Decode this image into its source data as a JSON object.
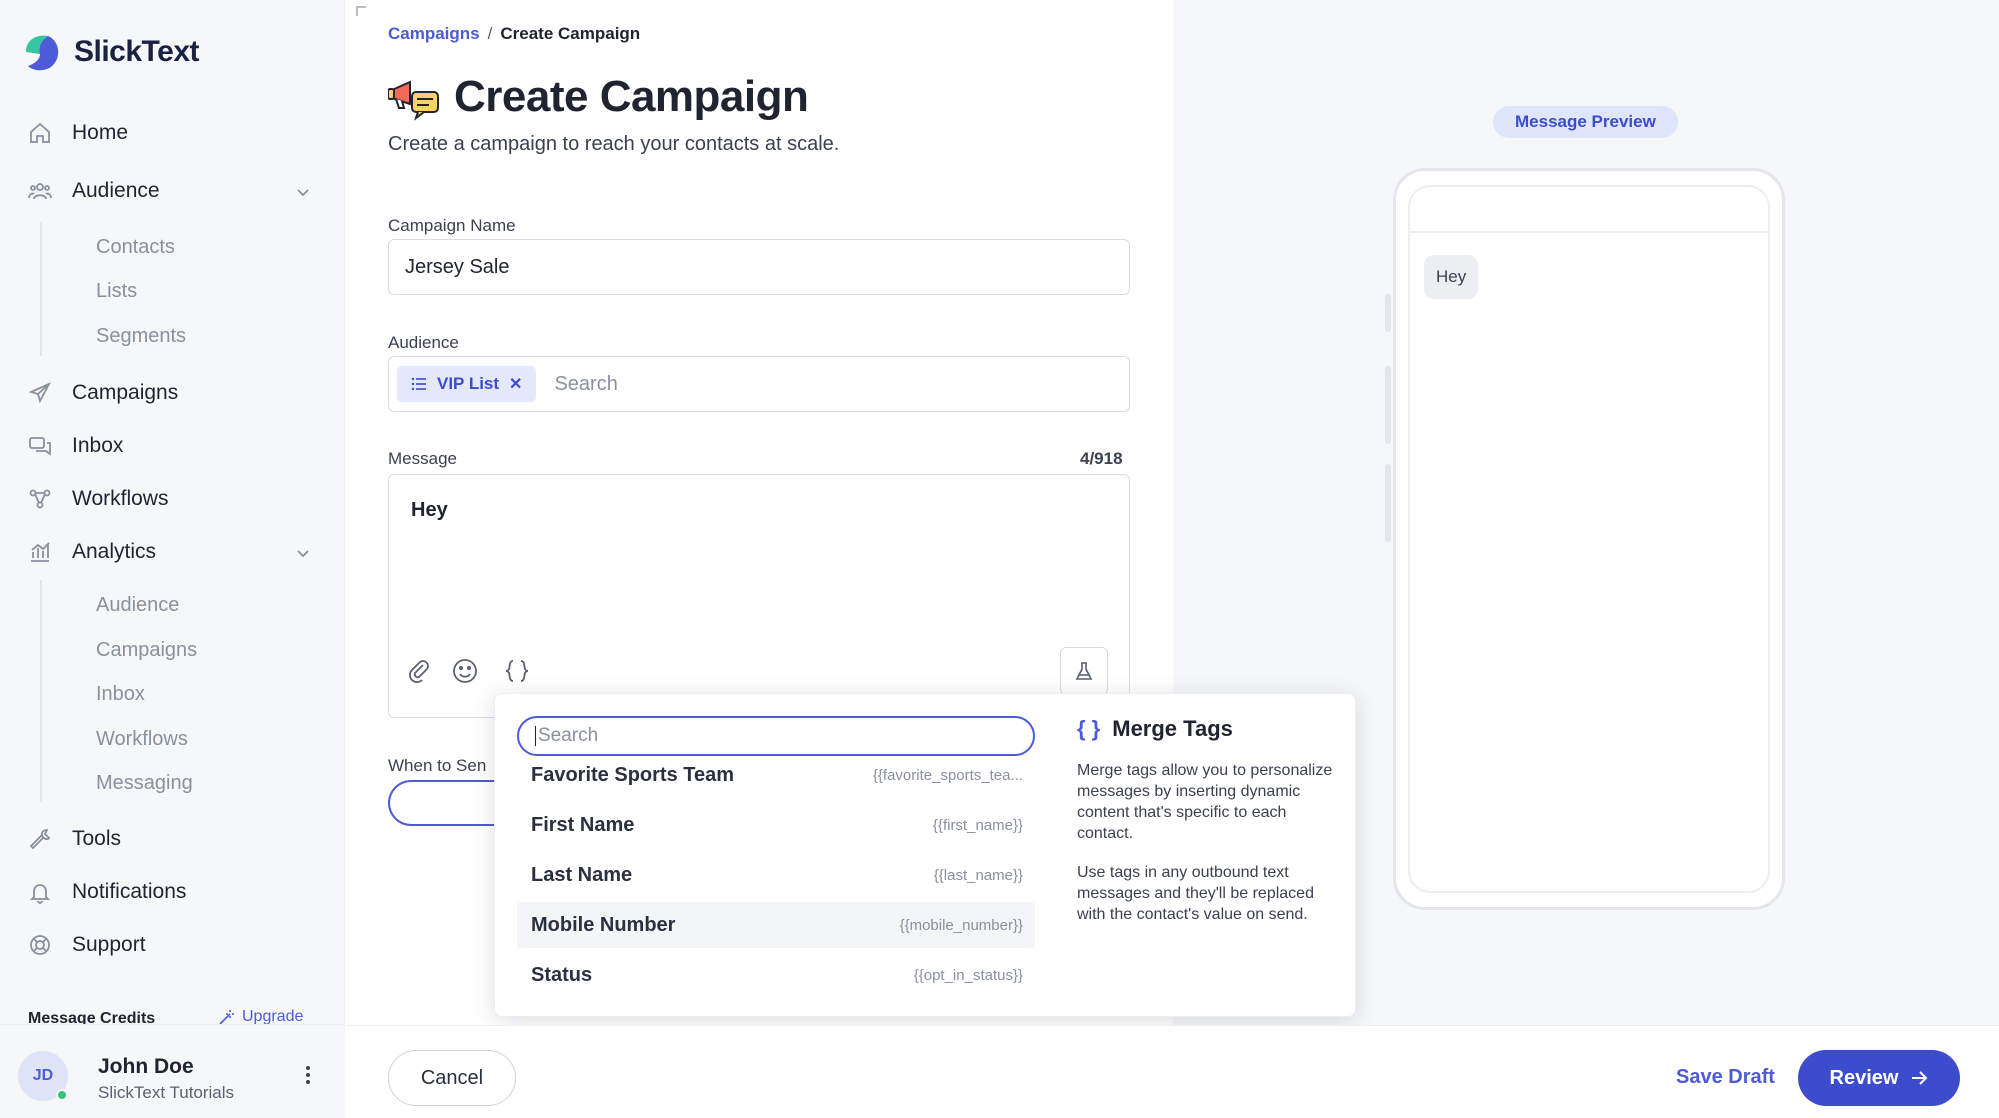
{
  "brand": {
    "name": "SlickText",
    "accent": "#3d4ccc",
    "logo_colors": [
      "#34c6a0",
      "#4d5bd6"
    ]
  },
  "sidebar": {
    "items": [
      {
        "label": "Home",
        "icon": "home-icon"
      },
      {
        "label": "Audience",
        "icon": "audience-icon",
        "expanded": true,
        "children": [
          "Contacts",
          "Lists",
          "Segments"
        ]
      },
      {
        "label": "Campaigns",
        "icon": "send-icon"
      },
      {
        "label": "Inbox",
        "icon": "chat-icon"
      },
      {
        "label": "Workflows",
        "icon": "workflow-icon"
      },
      {
        "label": "Analytics",
        "icon": "chart-icon",
        "expanded": true,
        "children": [
          "Audience",
          "Campaigns",
          "Inbox",
          "Workflows",
          "Messaging"
        ]
      },
      {
        "label": "Tools",
        "icon": "wrench-icon"
      },
      {
        "label": "Notifications",
        "icon": "bell-icon"
      },
      {
        "label": "Support",
        "icon": "lifebuoy-icon"
      }
    ],
    "credits_label": "Message Credits",
    "upgrade_label": "Upgrade",
    "user": {
      "initials": "JD",
      "name": "John Doe",
      "subtitle": "SlickText Tutorials"
    }
  },
  "breadcrumb": {
    "parent": "Campaigns",
    "separator": "/",
    "current": "Create Campaign"
  },
  "page": {
    "title": "Create Campaign",
    "subtitle": "Create a campaign to reach your contacts at scale."
  },
  "form": {
    "campaign_name_label": "Campaign Name",
    "campaign_name_value": "Jersey Sale",
    "audience_label": "Audience",
    "audience_chip": "VIP List",
    "audience_search_placeholder": "Search",
    "message_label": "Message",
    "message_counter": "4/918",
    "message_value": "Hey",
    "when_label": "When to Sen"
  },
  "merge_tags_popup": {
    "search_placeholder": "Search",
    "tags": [
      {
        "name": "Favorite Sports Team",
        "code": "{{favorite_sports_tea..."
      },
      {
        "name": "First Name",
        "code": "{{first_name}}"
      },
      {
        "name": "Last Name",
        "code": "{{last_name}}"
      },
      {
        "name": "Mobile Number",
        "code": "{{mobile_number}}"
      },
      {
        "name": "Status",
        "code": "{{opt_in_status}}"
      }
    ],
    "info_title": "Merge Tags",
    "info_p1": "Merge tags allow you to personalize messages by inserting dynamic content that's specific to each contact.",
    "info_p2": "Use tags in any outbound text messages and they'll be replaced with the contact's value on send."
  },
  "preview": {
    "badge": "Message Preview",
    "bubble": "Hey"
  },
  "footer": {
    "cancel": "Cancel",
    "save_draft": "Save Draft",
    "review": "Review"
  }
}
